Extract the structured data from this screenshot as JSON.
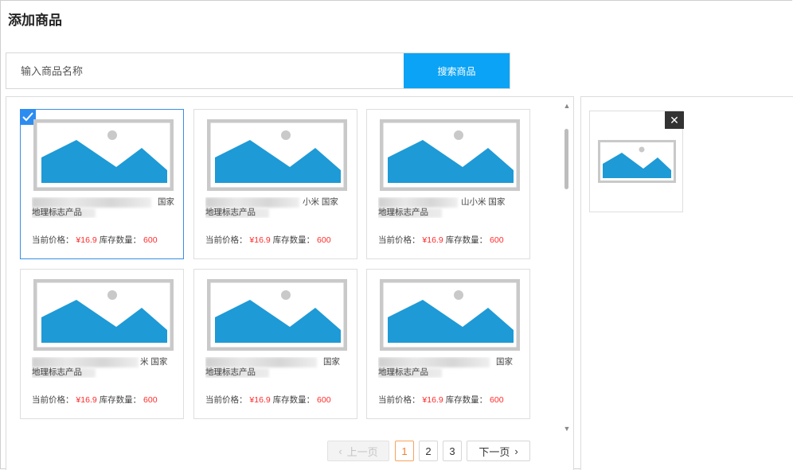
{
  "page": {
    "title": "添加商品"
  },
  "search": {
    "placeholder": "输入商品名称",
    "button_label": "搜索商品"
  },
  "products": [
    {
      "name_visible": "国家",
      "name_line2": "地理标志产品",
      "price_label": "当前价格：",
      "price": "¥16.9",
      "stock_label": "库存数量：",
      "stock": "600",
      "selected": true
    },
    {
      "name_visible": "小米 国家",
      "name_line2": "地理标志产品",
      "price_label": "当前价格：",
      "price": "¥16.9",
      "stock_label": "库存数量：",
      "stock": "600",
      "selected": false
    },
    {
      "name_visible": "山小米 国家",
      "name_line2": "地理标志产品",
      "price_label": "当前价格：",
      "price": "¥16.9",
      "stock_label": "库存数量：",
      "stock": "600",
      "selected": false
    },
    {
      "name_visible": "米 国家",
      "name_line2": "地理标志产品",
      "price_label": "当前价格：",
      "price": "¥16.9",
      "stock_label": "库存数量：",
      "stock": "600",
      "selected": false
    },
    {
      "name_visible": "国家",
      "name_line2": "地理标志产品",
      "price_label": "当前价格：",
      "price": "¥16.9",
      "stock_label": "库存数量：",
      "stock": "600",
      "selected": false
    },
    {
      "name_visible": "国家",
      "name_line2": "地理标志产品",
      "price_label": "当前价格：",
      "price": "¥16.9",
      "stock_label": "库存数量：",
      "stock": "600",
      "selected": false
    }
  ],
  "pagination": {
    "prev_label": "上一页",
    "pages": [
      "1",
      "2",
      "3"
    ],
    "current": "1",
    "next_label": "下一页"
  },
  "icons": {
    "check": "check-icon",
    "close": "close-icon",
    "image": "image-placeholder-icon",
    "chevron_left": "chevron-left-icon",
    "chevron_right": "chevron-right-icon"
  },
  "colors": {
    "accent": "#0ba3f5",
    "price_red": "#ff2a2a",
    "selected_border": "#3a8ee6",
    "active_page": "#f07f2b",
    "image_blue": "#1e9ad6",
    "image_frame": "#c9c9c9"
  }
}
